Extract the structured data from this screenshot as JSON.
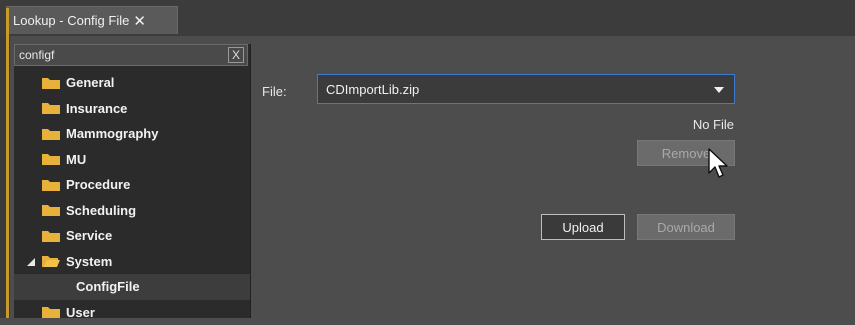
{
  "tab": {
    "title": "Lookup - Config File",
    "close": "✕"
  },
  "search": {
    "value": "configf",
    "clear_label": "X"
  },
  "tree": {
    "items": [
      {
        "label": "General"
      },
      {
        "label": "Insurance"
      },
      {
        "label": "Mammography"
      },
      {
        "label": "MU"
      },
      {
        "label": "Procedure"
      },
      {
        "label": "Scheduling"
      },
      {
        "label": "Service"
      },
      {
        "label": "System"
      },
      {
        "label": "ConfigFile"
      },
      {
        "label": "User"
      }
    ]
  },
  "form": {
    "file_label": "File:",
    "file_value": "CDImportLib.zip",
    "status": "No File",
    "remove_label": "Remove",
    "upload_label": "Upload",
    "download_label": "Download"
  },
  "colors": {
    "accent": "#3d7bd0",
    "folder": "#e8b23a"
  }
}
